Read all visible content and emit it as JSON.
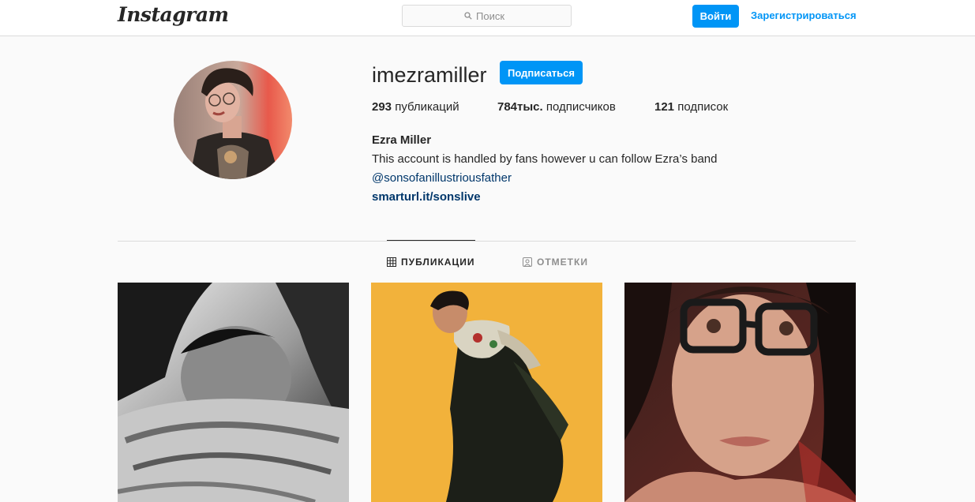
{
  "header": {
    "logo": "Instagram",
    "search_placeholder": "Поиск",
    "login_label": "Войти",
    "signup_label": "Зарегистрироваться"
  },
  "profile": {
    "username": "imezramiller",
    "follow_label": "Подписаться",
    "stats": {
      "posts_count": "293",
      "posts_label": "публикаций",
      "followers_count": "784тыс.",
      "followers_label": "подписчиков",
      "following_count": "121",
      "following_label": "подписок"
    },
    "full_name": "Ezra Miller",
    "bio": "This account is handled by fans however u can follow Ezra’s band",
    "mention": "@sonsofanillustriousfather",
    "link": "smarturl.it/sonslive"
  },
  "tabs": [
    {
      "label": "ПУБЛИКАЦИИ",
      "icon": "grid-icon",
      "active": true
    },
    {
      "label": "ОТМЕТКИ",
      "icon": "tag-person-icon",
      "active": false
    }
  ],
  "posts": [
    {
      "icon": "photo-bw-portrait"
    },
    {
      "icon": "photo-yellow-portrait"
    },
    {
      "icon": "photo-glasses-portrait"
    }
  ],
  "colors": {
    "accent": "#0095f6",
    "link": "#00376b",
    "background": "#fafafa",
    "border": "#dbdbdb"
  }
}
